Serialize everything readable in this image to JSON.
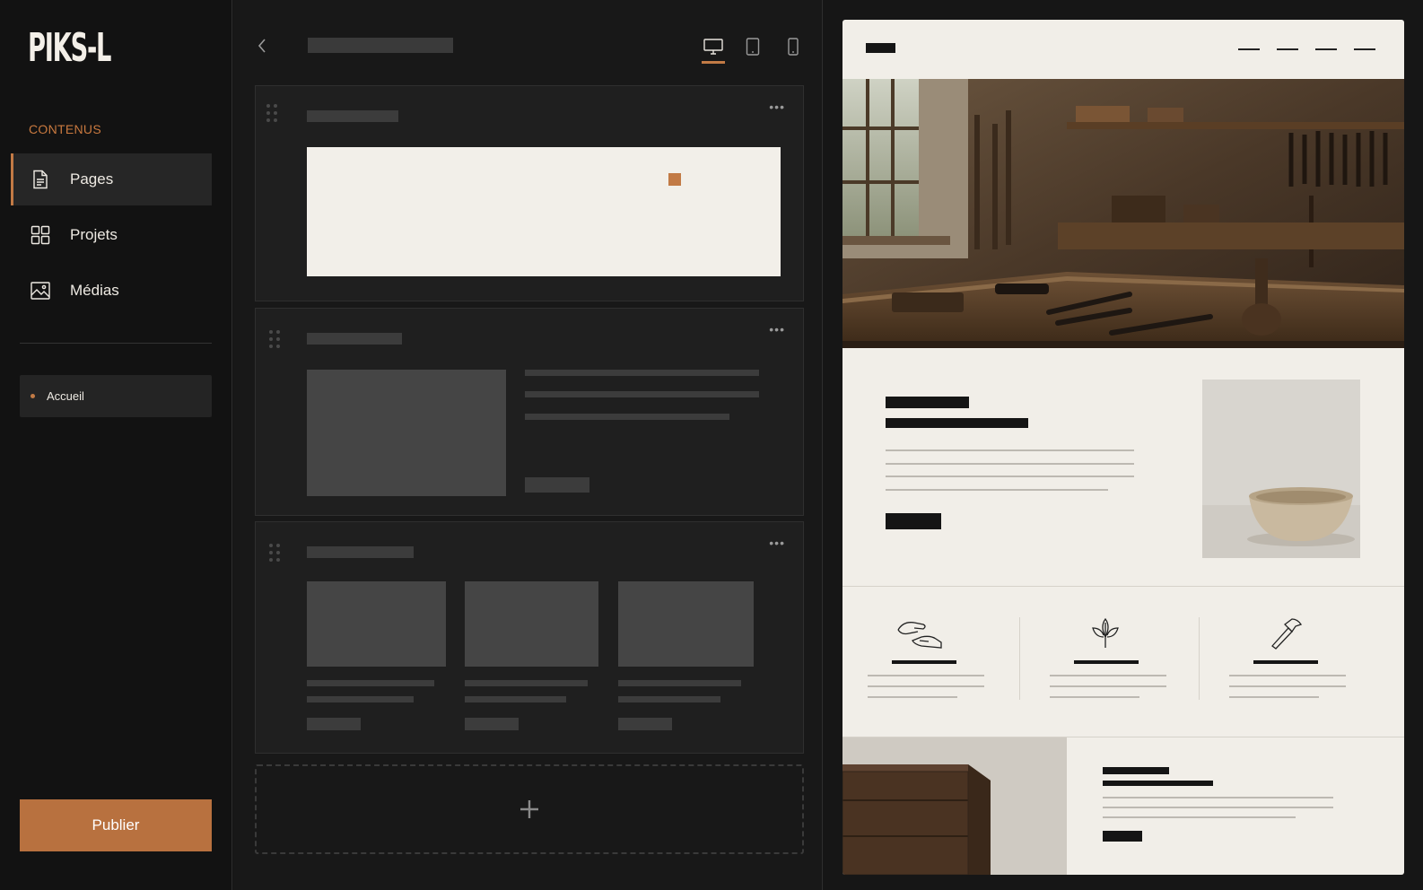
{
  "app": {
    "logo": "PIKS-L",
    "section_label": "CONTENUS",
    "nav": [
      {
        "label": "Pages",
        "icon": "document-icon",
        "active": true
      },
      {
        "label": "Projets",
        "icon": "grid-icon",
        "active": false
      },
      {
        "label": "Médias",
        "icon": "image-icon",
        "active": false
      }
    ],
    "pages": [
      {
        "label": "Accueil"
      }
    ],
    "publish_label": "Publier"
  },
  "editor": {
    "devices": [
      "desktop-icon",
      "tablet-icon",
      "mobile-icon"
    ],
    "active_device": "desktop",
    "add_block_label": "+"
  },
  "colors": {
    "accent": "#c27a45",
    "sidebar_bg": "#121212",
    "preview_bg": "#f1eee8"
  }
}
